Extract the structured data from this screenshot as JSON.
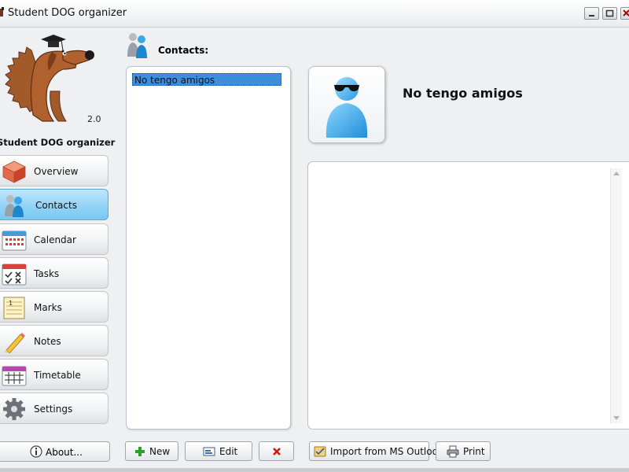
{
  "window": {
    "title": "Student DOG organizer"
  },
  "logo": {
    "version": "2.0",
    "app_name": "Student DOG organizer"
  },
  "nav": {
    "items": [
      {
        "label": "Overview",
        "icon": "cube-icon"
      },
      {
        "label": "Contacts",
        "icon": "people-icon",
        "active": true
      },
      {
        "label": "Calendar",
        "icon": "calendar-icon"
      },
      {
        "label": "Tasks",
        "icon": "tasks-checklist-icon"
      },
      {
        "label": "Marks",
        "icon": "notebook-icon"
      },
      {
        "label": "Notes",
        "icon": "pencil-icon"
      },
      {
        "label": "Timetable",
        "icon": "timetable-icon"
      },
      {
        "label": "Settings",
        "icon": "gear-icon"
      }
    ],
    "about_label": "About..."
  },
  "contacts": {
    "title": "Contacts:",
    "list": [
      "No tengo amigos"
    ],
    "selected_index": 0,
    "selected_name": "No tengo amigos"
  },
  "buttons": {
    "new_label": "New",
    "edit_label": "Edit",
    "import_label": "Import from MS Outlook",
    "print_label": "Print"
  },
  "colors": {
    "selection": "#3d8fdc",
    "active_nav": "#8fd2f7",
    "delete_red": "#d21414",
    "new_green": "#2aa12a"
  }
}
